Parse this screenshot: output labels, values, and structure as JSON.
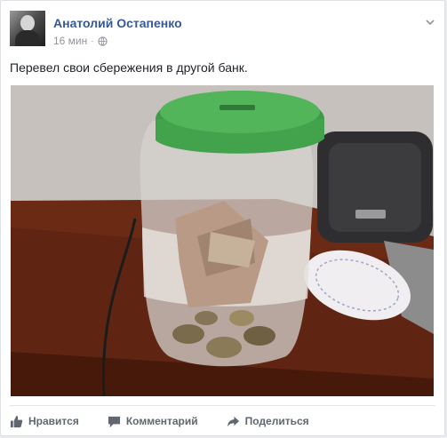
{
  "post": {
    "author": "Анатолий Остапенко",
    "time": "16 мин",
    "separator": "·",
    "text": "Перевел свои сбережения в другой банк."
  },
  "actions": {
    "like_label": "Нравится",
    "comment_label": "Комментарий",
    "share_label": "Поделиться"
  },
  "icons": {
    "menu": "chevron-down-icon",
    "privacy": "globe-icon",
    "like": "thumbs-up-icon",
    "comment": "comment-icon",
    "share": "share-arrow-icon"
  },
  "colors": {
    "author_name": "#365899",
    "muted": "#90949c",
    "action_text": "#606770",
    "jar_lid": "#4caf50"
  }
}
